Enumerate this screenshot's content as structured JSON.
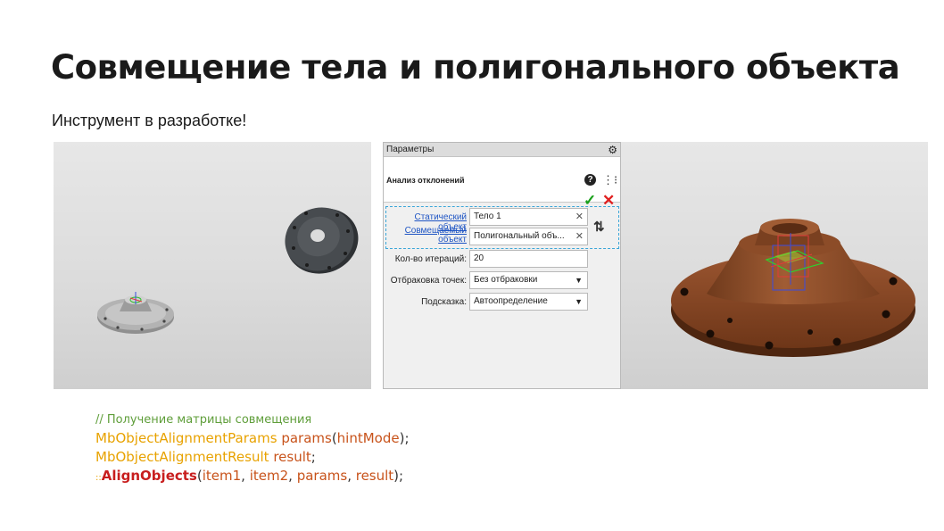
{
  "slide": {
    "title": "Совмещение тела и полигонального объекта",
    "subtitle": "Инструмент в разработке!"
  },
  "panel": {
    "header": "Параметры",
    "command": "Анализ отклонений",
    "icons": [
      "gear-icon",
      "help-icon",
      "tree-icon",
      "checkmark-icon",
      "close-icon",
      "swap-icon"
    ],
    "static_label": "Статический объект",
    "static_value": "Тело 1",
    "moving_label_1": "Совмещаемый",
    "moving_label_2": "объект",
    "moving_value": "Полигональный объ...",
    "iterations_label": "Кол-во итераций:",
    "iterations_value": "20",
    "rejection_label": "Отбраковка точек:",
    "rejection_value": "Без отбраковки",
    "hint_label": "Подсказка:",
    "hint_value": "Автоопределение"
  },
  "code": {
    "comment": "// Получение матрицы совмещения",
    "line2_type": "MbObjectAlignmentParams",
    "line2_var": "params",
    "line2_arg": "hintMode",
    "line3_type": "MbObjectAlignmentResult",
    "line3_var": "result",
    "line4_scope": "::",
    "line4_func": "AlignObjects",
    "line4_arg1": "item1",
    "line4_arg2": "item2",
    "line4_arg3": "params",
    "line4_arg4": "result",
    "p_open": "(",
    "p_close": ");",
    "semicolon": ";",
    "comma": ", "
  },
  "colors": {
    "model_gray": "#a9a9a9",
    "polygon_dark": "#3f4245",
    "result_brown": "#8a4a26",
    "code_type": "#e8a200",
    "code_var": "#c8531b",
    "code_func": "#c81e1e",
    "code_comment": "#5f9e3a",
    "ok_green": "#19a01a",
    "cancel_red": "#e02020"
  }
}
